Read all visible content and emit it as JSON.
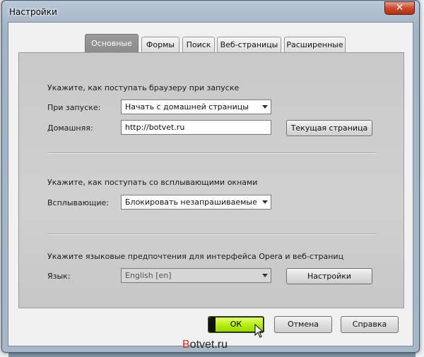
{
  "window": {
    "title": "Настройки",
    "close_label": "✕"
  },
  "tabs": [
    {
      "label": "Основные",
      "active": true
    },
    {
      "label": "Формы",
      "active": false
    },
    {
      "label": "Поиск",
      "active": false
    },
    {
      "label": "Веб-страницы",
      "active": false
    },
    {
      "label": "Расширенные",
      "active": false
    }
  ],
  "startup": {
    "header": "Укажите, как поступать браузеру при запуске",
    "startup_label": "При запуске:",
    "startup_value": "Начать с домашней страницы",
    "home_label": "Домашняя:",
    "home_value": "http://botvet.ru",
    "current_page_button": "Текущая страница"
  },
  "popups": {
    "header": "Укажите, как поступать со всплывающими окнами",
    "popups_label": "Всплывающие:",
    "popups_value": "Блокировать незапрашиваемые"
  },
  "language": {
    "header": "Укажите языковые предпочтения для интерфейса Opera и веб-страниц",
    "language_label": "Язык:",
    "language_value": "English [en]",
    "settings_button": "Настройки"
  },
  "footer": {
    "ok_label": "ОК",
    "cancel_label": "Отмена",
    "help_label": "Справка"
  },
  "watermark": {
    "first_letter": "B",
    "rest": "otvet.ru"
  },
  "colors": {
    "ok_accent": "#b8ef10",
    "active_tab": "#8c8c8c",
    "close_button": "#c8492e"
  }
}
